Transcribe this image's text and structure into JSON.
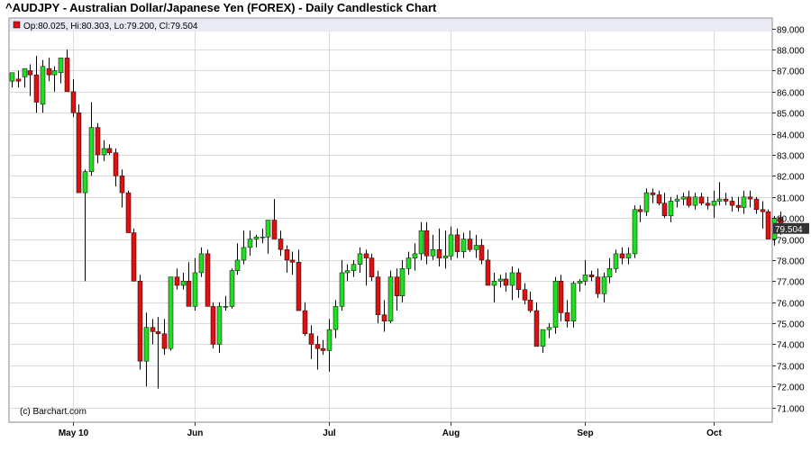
{
  "chart_title": "^AUDJPY - Australian Dollar/Japanese Yen (FOREX) - Daily Candlestick Chart",
  "ohlc_label": "Op:80.025, Hi:80.303, Lo:79.200, Cl:79.504",
  "credit": "(c) Barchart.com",
  "last_price_label": "79.504",
  "colors": {
    "up": "#22dd22",
    "down": "#dd1111",
    "wick": "#000000",
    "grid": "#cccccc",
    "band": "#e8eaf6",
    "last_bg": "#333333"
  },
  "chart_data": {
    "type": "candlestick",
    "title": "^AUDJPY - Australian Dollar/Japanese Yen (FOREX) - Daily Candlestick Chart",
    "ylim": [
      70.3,
      89.5
    ],
    "yticks": [
      71,
      72,
      73,
      74,
      75,
      76,
      77,
      78,
      79,
      80,
      81,
      82,
      83,
      84,
      85,
      86,
      87,
      88,
      89
    ],
    "ytick_labels": [
      "71.000",
      "72.000",
      "73.000",
      "74.000",
      "75.000",
      "76.000",
      "77.000",
      "78.000",
      "79.000",
      "80.000",
      "81.000",
      "82.000",
      "83.000",
      "84.000",
      "85.000",
      "86.000",
      "87.000",
      "88.000",
      "89.000"
    ],
    "xtick_labels": [
      "May 10",
      "Jun",
      "Jul",
      "Aug",
      "Sep",
      "Oct"
    ],
    "xtick_positions": [
      10,
      30,
      52,
      72,
      94,
      115
    ],
    "candles": [
      [
        86.5,
        86.8,
        86.2,
        86.9
      ],
      [
        86.6,
        87.0,
        86.2,
        86.5
      ],
      [
        86.7,
        87.1,
        86.2,
        87.1
      ],
      [
        87.0,
        87.3,
        85.8,
        86.8
      ],
      [
        86.8,
        87.7,
        85.0,
        85.5
      ],
      [
        85.4,
        87.5,
        85.0,
        87.2
      ],
      [
        87.1,
        87.6,
        86.5,
        86.8
      ],
      [
        86.8,
        87.2,
        86.0,
        87.0
      ],
      [
        86.9,
        87.4,
        86.4,
        87.6
      ],
      [
        87.6,
        88.0,
        86.6,
        86.0
      ],
      [
        86.0,
        86.6,
        84.8,
        85.0
      ],
      [
        85.0,
        85.4,
        82.0,
        81.2
      ],
      [
        81.2,
        82.3,
        77.0,
        82.2
      ],
      [
        82.2,
        85.5,
        82.0,
        84.3
      ],
      [
        84.3,
        84.5,
        82.6,
        83.0
      ],
      [
        83.0,
        83.7,
        82.7,
        83.3
      ],
      [
        83.3,
        83.5,
        83.0,
        83.1
      ],
      [
        83.1,
        83.3,
        81.5,
        82.0
      ],
      [
        82.0,
        82.3,
        80.5,
        81.2
      ],
      [
        81.2,
        81.3,
        79.3,
        79.3
      ],
      [
        79.3,
        79.5,
        77.0,
        77.0
      ],
      [
        77.0,
        77.3,
        72.8,
        73.2
      ],
      [
        73.2,
        75.5,
        72.0,
        74.8
      ],
      [
        74.8,
        75.2,
        74.0,
        74.6
      ],
      [
        74.6,
        75.3,
        71.9,
        74.5
      ],
      [
        74.5,
        75.2,
        73.5,
        73.8
      ],
      [
        73.8,
        77.0,
        73.7,
        77.2
      ],
      [
        77.2,
        77.6,
        76.6,
        76.8
      ],
      [
        76.8,
        77.4,
        76.6,
        77.0
      ],
      [
        77.0,
        77.9,
        75.8,
        75.8
      ],
      [
        75.8,
        78.1,
        75.6,
        77.4
      ],
      [
        77.4,
        78.6,
        77.2,
        78.3
      ],
      [
        78.3,
        78.5,
        75.8,
        75.8
      ],
      [
        75.8,
        76.0,
        73.8,
        74.0
      ],
      [
        74.0,
        76.0,
        73.6,
        75.8
      ],
      [
        75.8,
        76.3,
        75.6,
        75.8
      ],
      [
        75.8,
        77.6,
        75.7,
        77.5
      ],
      [
        77.5,
        78.8,
        77.3,
        78.0
      ],
      [
        78.0,
        79.4,
        77.8,
        78.6
      ],
      [
        78.6,
        79.4,
        78.2,
        79.0
      ],
      [
        79.0,
        79.2,
        78.6,
        79.1
      ],
      [
        79.1,
        79.5,
        78.8,
        79.1
      ],
      [
        79.1,
        79.9,
        78.3,
        79.9
      ],
      [
        79.9,
        80.9,
        79.5,
        79.0
      ],
      [
        79.0,
        79.4,
        78.2,
        78.5
      ],
      [
        78.5,
        78.7,
        77.4,
        78.0
      ],
      [
        78.0,
        78.4,
        77.3,
        77.9
      ],
      [
        77.9,
        78.5,
        75.8,
        75.6
      ],
      [
        75.6,
        76.0,
        74.4,
        74.5
      ],
      [
        74.5,
        74.9,
        73.3,
        74.0
      ],
      [
        74.0,
        74.4,
        72.8,
        73.8
      ],
      [
        73.8,
        74.2,
        73.5,
        73.7
      ],
      [
        73.7,
        75.2,
        72.7,
        74.7
      ],
      [
        74.7,
        76.1,
        74.3,
        75.8
      ],
      [
        75.8,
        78.0,
        75.6,
        77.4
      ],
      [
        77.4,
        77.8,
        77.0,
        77.5
      ],
      [
        77.5,
        78.0,
        77.2,
        77.8
      ],
      [
        77.8,
        78.6,
        77.4,
        78.3
      ],
      [
        78.3,
        78.5,
        76.8,
        78.1
      ],
      [
        78.1,
        78.3,
        77.0,
        77.2
      ],
      [
        77.2,
        77.5,
        75.0,
        75.4
      ],
      [
        75.4,
        76.1,
        74.6,
        75.1
      ],
      [
        75.1,
        77.5,
        75.0,
        77.2
      ],
      [
        77.2,
        77.6,
        75.6,
        76.3
      ],
      [
        76.3,
        78.0,
        76.0,
        77.6
      ],
      [
        77.6,
        78.4,
        77.3,
        78.1
      ],
      [
        78.1,
        78.8,
        77.5,
        78.3
      ],
      [
        78.3,
        79.8,
        78.0,
        79.4
      ],
      [
        79.4,
        79.8,
        77.8,
        78.2
      ],
      [
        78.2,
        79.2,
        78.0,
        78.5
      ],
      [
        78.5,
        79.5,
        77.7,
        78.1
      ],
      [
        78.1,
        79.4,
        77.6,
        78.2
      ],
      [
        78.2,
        79.6,
        78.0,
        79.2
      ],
      [
        79.2,
        79.5,
        78.1,
        78.4
      ],
      [
        78.4,
        79.3,
        78.1,
        79.0
      ],
      [
        79.0,
        79.4,
        78.4,
        78.5
      ],
      [
        78.5,
        79.2,
        78.1,
        78.7
      ],
      [
        78.7,
        79.0,
        77.8,
        78.0
      ],
      [
        78.0,
        78.5,
        77.6,
        76.8
      ],
      [
        76.8,
        77.4,
        76.0,
        77.0
      ],
      [
        77.0,
        77.3,
        76.7,
        77.1
      ],
      [
        77.1,
        77.4,
        76.5,
        76.8
      ],
      [
        76.8,
        77.7,
        76.1,
        77.4
      ],
      [
        77.4,
        77.6,
        76.2,
        76.6
      ],
      [
        76.6,
        76.9,
        75.9,
        76.1
      ],
      [
        76.1,
        76.5,
        75.5,
        75.6
      ],
      [
        75.6,
        76.0,
        74.1,
        73.9
      ],
      [
        73.9,
        74.6,
        73.6,
        74.7
      ],
      [
        74.7,
        75.0,
        74.3,
        74.8
      ],
      [
        74.8,
        77.2,
        74.5,
        77.0
      ],
      [
        77.0,
        77.3,
        75.1,
        75.5
      ],
      [
        75.5,
        76.1,
        74.8,
        75.1
      ],
      [
        75.1,
        77.0,
        74.8,
        76.9
      ],
      [
        76.9,
        77.1,
        76.5,
        77.0
      ],
      [
        77.0,
        78.0,
        76.8,
        77.3
      ],
      [
        77.3,
        77.5,
        77.0,
        77.2
      ],
      [
        77.2,
        77.6,
        76.2,
        76.4
      ],
      [
        76.4,
        77.4,
        76.0,
        77.2
      ],
      [
        77.2,
        78.1,
        76.9,
        77.6
      ],
      [
        77.6,
        78.5,
        77.4,
        78.3
      ],
      [
        78.3,
        78.6,
        77.8,
        78.1
      ],
      [
        78.1,
        78.6,
        77.8,
        78.3
      ],
      [
        78.3,
        80.6,
        78.1,
        80.4
      ],
      [
        80.4,
        80.6,
        79.8,
        80.3
      ],
      [
        80.3,
        81.4,
        80.1,
        81.2
      ],
      [
        81.2,
        81.4,
        80.7,
        81.1
      ],
      [
        81.1,
        81.3,
        80.6,
        80.7
      ],
      [
        80.7,
        81.2,
        80.0,
        80.1
      ],
      [
        80.1,
        81.0,
        79.8,
        80.8
      ],
      [
        80.8,
        81.1,
        80.5,
        80.9
      ],
      [
        80.9,
        81.2,
        80.6,
        81.0
      ],
      [
        81.0,
        81.3,
        80.5,
        80.6
      ],
      [
        80.6,
        81.2,
        80.4,
        81.0
      ],
      [
        81.0,
        81.2,
        80.6,
        80.7
      ],
      [
        80.7,
        81.0,
        80.4,
        80.6
      ],
      [
        80.6,
        81.3,
        80.0,
        80.8
      ],
      [
        80.8,
        81.7,
        80.6,
        80.9
      ],
      [
        80.9,
        81.2,
        80.6,
        80.8
      ],
      [
        80.8,
        81.0,
        80.3,
        80.6
      ],
      [
        80.6,
        81.0,
        80.3,
        80.5
      ],
      [
        80.5,
        81.3,
        80.2,
        81.0
      ],
      [
        81.0,
        81.3,
        80.5,
        80.9
      ],
      [
        80.9,
        81.0,
        80.2,
        80.4
      ],
      [
        80.4,
        80.8,
        79.5,
        80.3
      ],
      [
        80.3,
        80.4,
        79.0,
        79.0
      ],
      [
        79.0,
        80.1,
        78.7,
        80.0
      ],
      [
        80.025,
        80.303,
        79.2,
        79.504
      ]
    ]
  }
}
